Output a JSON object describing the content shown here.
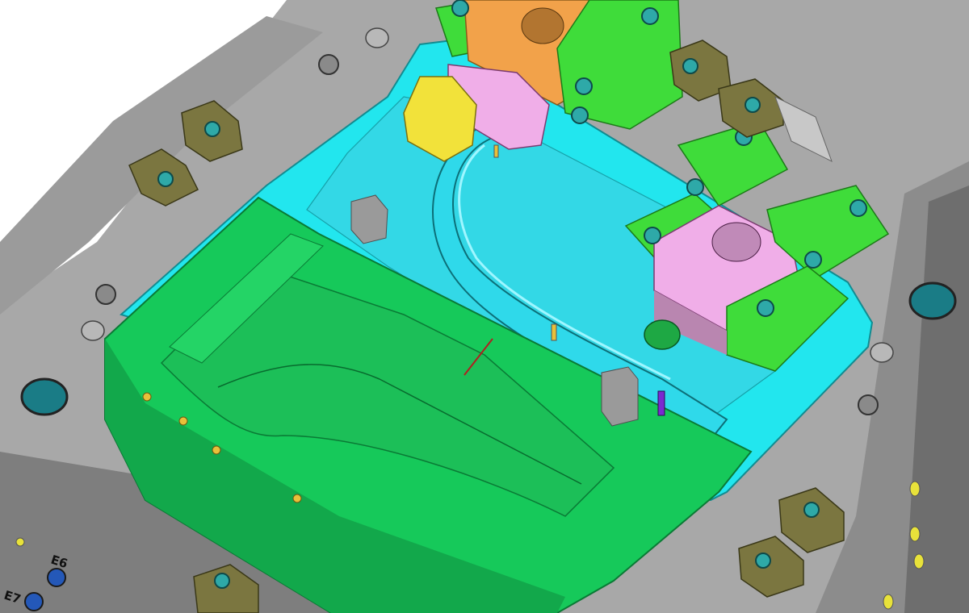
{
  "scene": {
    "description_visible_text": "",
    "labels": {
      "port_upper": "E6",
      "port_lower": "E7"
    },
    "colors": {
      "background": "#ffffff",
      "frame_plate": "#a6a6a6",
      "frame_plate_dark": "#6f6f6f",
      "cavity_plate": "#22e6ee",
      "insert": "#1fc45a",
      "insert_dark": "#139040",
      "slider_block": "#3fdc3a",
      "slider_pink": "#f0aee8",
      "slider_orange": "#f2a24a",
      "lifter_yellow": "#f2e23a",
      "clamp_olive": "#7b7640",
      "bolt_cyan": "#2ea9a8",
      "port_yellow": "#e8e23a",
      "port_blue": "#2458b8"
    }
  }
}
